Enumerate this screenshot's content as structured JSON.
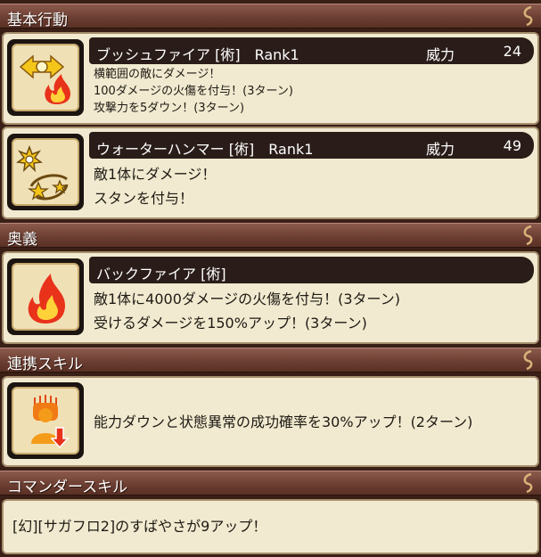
{
  "sections": {
    "basic": "基本行動",
    "ougi": "奥義",
    "renkei": "連携スキル",
    "commander": "コマンダースキル"
  },
  "skills": {
    "bushfire": {
      "name": "ブッシュファイア [術]　Rank1",
      "power_label": "威力",
      "power_value": "24",
      "lines": [
        "横範囲の敵にダメージ！",
        "100ダメージの火傷を付与！(3ターン)",
        "攻撃力を5ダウン！(3ターン)"
      ],
      "icon": "fire-area-icon"
    },
    "waterhammer": {
      "name": "ウォーターハンマー [術]　Rank1",
      "power_label": "威力",
      "power_value": "49",
      "lines": [
        "敵1体にダメージ！",
        "スタンを付与！"
      ],
      "icon": "stun-icon"
    },
    "backfire": {
      "name": "バックファイア [術]",
      "lines": [
        "敵1体に4000ダメージの火傷を付与！(3ターン)",
        "受けるダメージを150%アップ！(3ターン)"
      ],
      "icon": "fire-icon"
    }
  },
  "renkei": {
    "text": "能力ダウンと状態異常の成功確率を30%アップ！(2ターン)",
    "icon": "debuff-up-icon"
  },
  "commander": {
    "text": "[幻][サガフロ2]のすばやさが9アップ！"
  },
  "colors": {
    "header_bg": "#6a3d31",
    "panel_bg": "#f1ead0",
    "title_bar_bg": "#2a1d19",
    "fire_red": "#e8321a",
    "fire_yellow": "#ffd23a"
  }
}
